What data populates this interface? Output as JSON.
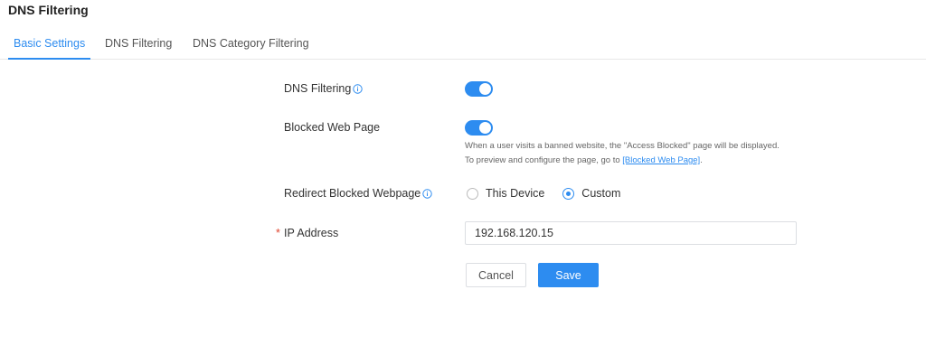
{
  "page": {
    "title": "DNS Filtering"
  },
  "tabs": [
    {
      "label": "Basic Settings",
      "active": true
    },
    {
      "label": "DNS Filtering",
      "active": false
    },
    {
      "label": "DNS Category Filtering",
      "active": false
    }
  ],
  "form": {
    "dns_filtering": {
      "label": "DNS Filtering",
      "enabled": true
    },
    "blocked_web_page": {
      "label": "Blocked Web Page",
      "enabled": true,
      "description": "When a user visits a banned website, the \"Access Blocked\" page will be displayed. To preview and configure the page, go to ",
      "link_text": "[Blocked Web Page]",
      "description_end": "."
    },
    "redirect": {
      "label": "Redirect Blocked Webpage",
      "options": [
        "This Device",
        "Custom"
      ],
      "selected": "Custom"
    },
    "ip_address": {
      "label": "IP Address",
      "required_mark": "*",
      "value": "192.168.120.15"
    }
  },
  "buttons": {
    "cancel": "Cancel",
    "save": "Save"
  },
  "colors": {
    "accent": "#2d8cf0",
    "required": "#e0452f"
  }
}
